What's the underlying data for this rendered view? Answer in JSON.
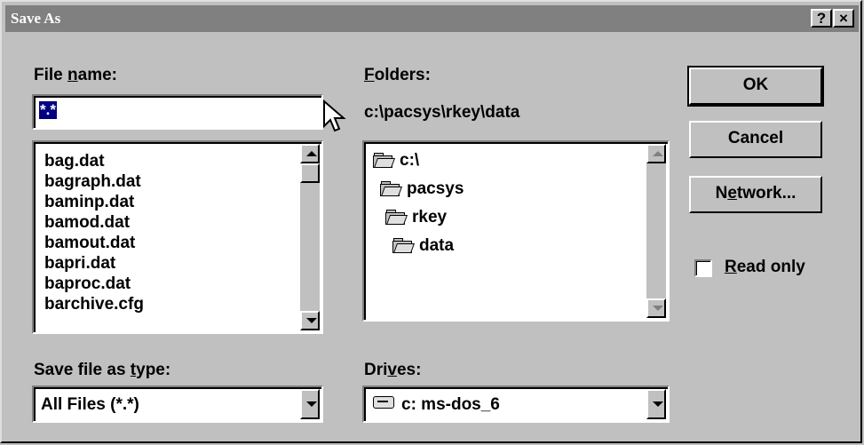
{
  "window": {
    "title": "Save As",
    "help_button": "?",
    "close_button": "×"
  },
  "file_name": {
    "label_prefix": "File ",
    "label_mnemonic": "n",
    "label_suffix": "ame:",
    "value": "*.*"
  },
  "files": {
    "items": [
      "bag.dat",
      "bagraph.dat",
      "baminp.dat",
      "bamod.dat",
      "bamout.dat",
      "bapri.dat",
      "baproc.dat",
      "barchive.cfg"
    ]
  },
  "folders": {
    "label_mnemonic": "F",
    "label_suffix": "olders:",
    "current_path": "c:\\pacsys\\rkey\\data",
    "tree": [
      "c:\\",
      "pacsys",
      "rkey",
      "data"
    ]
  },
  "buttons": {
    "ok": "OK",
    "cancel": "Cancel",
    "network_prefix": "N",
    "network_mnemonic": "e",
    "network_suffix": "twork..."
  },
  "read_only": {
    "mnemonic": "R",
    "label_suffix": "ead only",
    "checked": false
  },
  "save_type": {
    "label_prefix": "Save file as ",
    "label_mnemonic": "t",
    "label_suffix": "ype:",
    "value": "All Files (*.*)"
  },
  "drives": {
    "label_prefix": "Dri",
    "label_mnemonic": "v",
    "label_suffix": "es:",
    "value": "c: ms-dos_6"
  }
}
